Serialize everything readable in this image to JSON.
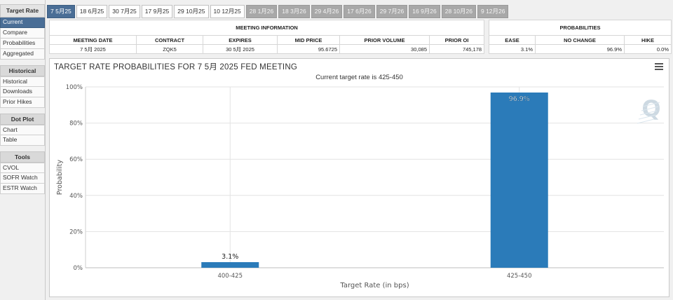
{
  "sidebar": {
    "groups": [
      {
        "title": "Target Rate",
        "items": [
          {
            "label": "Current",
            "active": true
          },
          {
            "label": "Compare"
          },
          {
            "label": "Probabilities"
          },
          {
            "label": "Aggregated"
          }
        ]
      },
      {
        "title": "Historical",
        "items": [
          {
            "label": "Historical"
          },
          {
            "label": "Downloads"
          },
          {
            "label": "Prior Hikes"
          }
        ]
      },
      {
        "title": "Dot Plot",
        "items": [
          {
            "label": "Chart"
          },
          {
            "label": "Table"
          }
        ]
      },
      {
        "title": "Tools",
        "items": [
          {
            "label": "CVOL"
          },
          {
            "label": "SOFR Watch"
          },
          {
            "label": "ESTR Watch"
          }
        ]
      }
    ]
  },
  "tabs": [
    {
      "label": "7 5月25",
      "state": "active"
    },
    {
      "label": "18 6月25",
      "state": "normal"
    },
    {
      "label": "30 7月25",
      "state": "normal"
    },
    {
      "label": "17 9月25",
      "state": "normal"
    },
    {
      "label": "29 10月25",
      "state": "normal"
    },
    {
      "label": "10 12月25",
      "state": "normal"
    },
    {
      "label": "28 1月26",
      "state": "future"
    },
    {
      "label": "18 3月26",
      "state": "future"
    },
    {
      "label": "29 4月26",
      "state": "future"
    },
    {
      "label": "17 6月26",
      "state": "future"
    },
    {
      "label": "29 7月26",
      "state": "future"
    },
    {
      "label": "16 9月26",
      "state": "future"
    },
    {
      "label": "28 10月26",
      "state": "future"
    },
    {
      "label": "9 12月26",
      "state": "future"
    }
  ],
  "meeting_info": {
    "title": "MEETING INFORMATION",
    "headers": [
      "MEETING DATE",
      "CONTRACT",
      "EXPIRES",
      "MID PRICE",
      "PRIOR VOLUME",
      "PRIOR OI"
    ],
    "row": [
      "7 5月 2025",
      "ZQK5",
      "30 5月 2025",
      "95.6725",
      "30,085",
      "745,178"
    ]
  },
  "probabilities": {
    "title": "PROBABILITIES",
    "headers": [
      "EASE",
      "NO CHANGE",
      "HIKE"
    ],
    "row": [
      "3.1%",
      "96.9%",
      "0.0%"
    ]
  },
  "chart": {
    "title": "TARGET RATE PROBABILITIES FOR 7 5月 2025 FED MEETING",
    "subtitle": "Current target rate is 425-450",
    "menu_icon": "hamburger-menu-icon",
    "watermark": "Q",
    "bar_color": "#2b7bb9"
  },
  "chart_data": {
    "type": "bar",
    "title": "TARGET RATE PROBABILITIES FOR 7 5月 2025 FED MEETING",
    "subtitle": "Current target rate is 425-450",
    "xlabel": "Target Rate (in bps)",
    "ylabel": "Probability",
    "categories": [
      "400-425",
      "425-450"
    ],
    "values": [
      3.1,
      96.9
    ],
    "data_labels": [
      "3.1%",
      "96.9%"
    ],
    "ylim": [
      0,
      100
    ],
    "yticks": [
      "0%",
      "20%",
      "40%",
      "60%",
      "80%",
      "100%"
    ],
    "ytick_values": [
      0,
      20,
      40,
      60,
      80,
      100
    ],
    "grid": true,
    "legend": "none"
  }
}
